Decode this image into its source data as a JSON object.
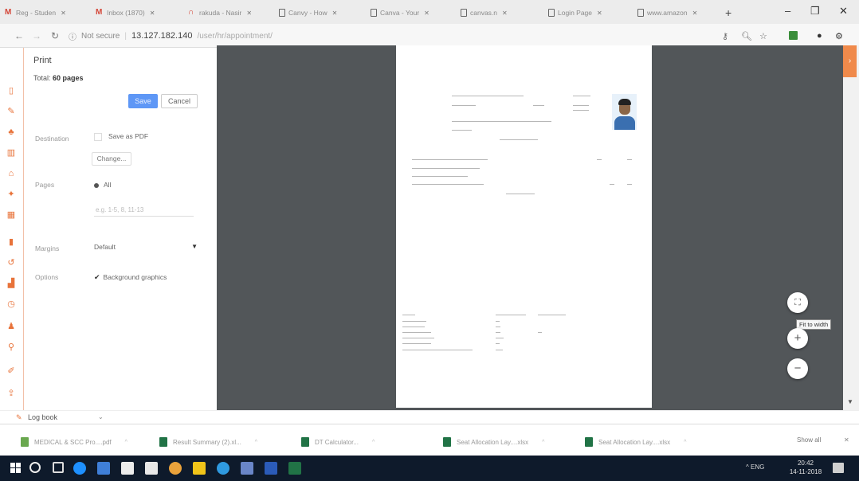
{
  "browser": {
    "tabs": [
      {
        "label": "Reg - Studen",
        "icon": "gmail-icon"
      },
      {
        "label": "Inbox (1870)",
        "icon": "gmail-icon"
      },
      {
        "label": "rakuda - Nasir",
        "icon": "arch-icon"
      },
      {
        "label": "Canvy - How",
        "icon": "page-icon"
      },
      {
        "label": "Canva - Your",
        "icon": "page-icon"
      },
      {
        "label": "canvas.n",
        "icon": "page-icon"
      },
      {
        "label": "Login Page",
        "icon": "page-icon"
      },
      {
        "label": "www.amazon",
        "icon": "page-icon"
      }
    ],
    "new_tab": "+",
    "window_controls": {
      "minimize": "–",
      "maximize": "❐",
      "close": "✕"
    },
    "address": {
      "security": "Not secure",
      "host": "13.127.182.140",
      "path": "/user/hr/appointment/"
    }
  },
  "print_panel": {
    "title": "Print",
    "total_label": "Total:",
    "total_value": "60 pages",
    "save_label": "Save",
    "cancel_label": "Cancel",
    "destination_label": "Destination",
    "destination_value": "Save as PDF",
    "change_label": "Change...",
    "pages_label": "Pages",
    "pages_all": "All",
    "pages_placeholder": "e.g. 1-5, 8, 11-13",
    "margins_label": "Margins",
    "margins_value": "Default",
    "options_label": "Options",
    "options_value": "Background graphics"
  },
  "preview": {
    "fit_to_width_tooltip": "Fit to width",
    "zoom_in": "+",
    "zoom_out": "−"
  },
  "logbook": {
    "label": "Log book"
  },
  "downloads": {
    "items": [
      {
        "label": "MEDICAL & SCC Pro....pdf",
        "color": "#6aa84f"
      },
      {
        "label": "Result Summary (2).xl...",
        "color": "#217346"
      },
      {
        "label": "DT Calculator...",
        "color": "#217346"
      },
      {
        "label": "Seat Allocation Lay....xlsx",
        "color": "#217346"
      },
      {
        "label": "Seat Allocation Lay....xlsx",
        "color": "#217346"
      }
    ],
    "show_all": "Show all"
  },
  "taskbar": {
    "tray_text": "^  ENG",
    "time": "20:42",
    "date": "14-11-2018"
  }
}
